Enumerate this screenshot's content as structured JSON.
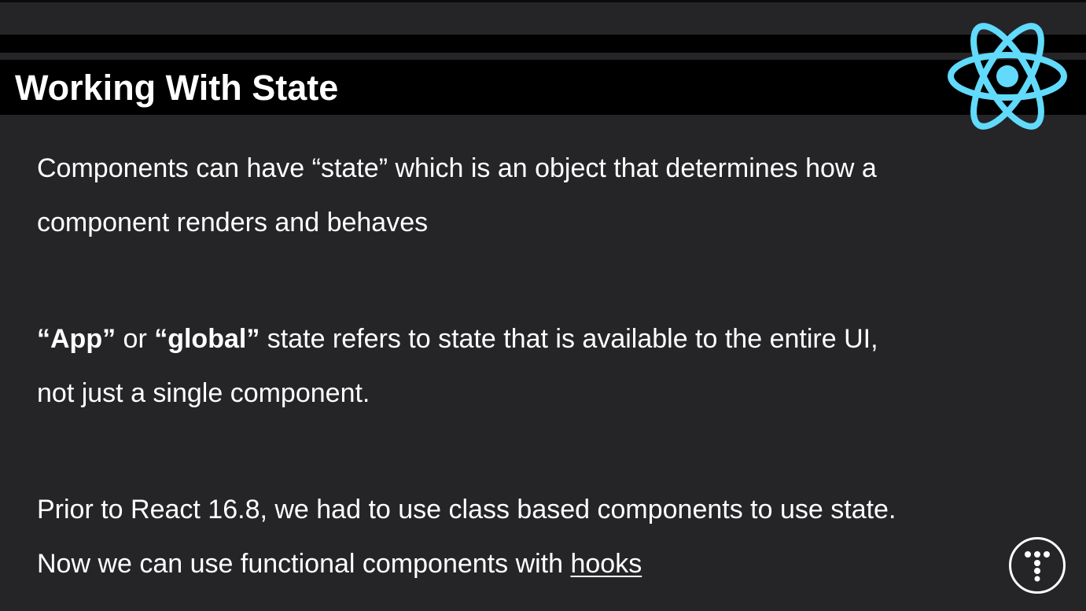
{
  "slide": {
    "title": "Working With State",
    "paragraph1": {
      "line1": "Components can have “state” which is an object that determines how a",
      "line2": "component renders and behaves"
    },
    "paragraph2": {
      "app_term": "“App”",
      "or_word": " or ",
      "global_term": "“global”",
      "line1_rest": " state refers to state that is available to the entire UI,",
      "line2": "not just a single component."
    },
    "paragraph3": {
      "line1": "Prior to React 16.8, we had to use class based components to use state.",
      "line2_prefix": "Now we can use functional components with ",
      "hooks_link": "hooks"
    }
  },
  "icons": {
    "react_logo": "react-atom-icon",
    "brand_badge": "traversy-t-logo-icon"
  },
  "colors": {
    "background": "#252528",
    "title_band": "#000000",
    "text": "#ffffff",
    "react_blue": "#61dafb"
  }
}
